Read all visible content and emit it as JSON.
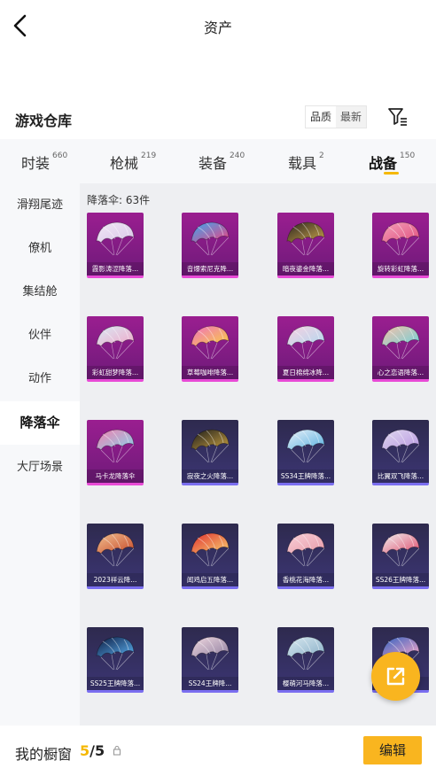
{
  "header": {
    "title": "资产"
  },
  "warehouse": {
    "title": "游戏仓库",
    "sort_options": [
      "品质",
      "最新"
    ]
  },
  "tabs": [
    {
      "label": "时装",
      "count": "660"
    },
    {
      "label": "枪械",
      "count": "219"
    },
    {
      "label": "装备",
      "count": "240"
    },
    {
      "label": "载具",
      "count": "2"
    },
    {
      "label": "战备",
      "count": "150"
    }
  ],
  "sidebar": {
    "items": [
      "滑翔尾迹",
      "僚机",
      "集结舱",
      "伙伴",
      "动作",
      "降落伞",
      "大厅场景"
    ]
  },
  "content": {
    "header": "降落伞: 63件",
    "items": [
      {
        "name": "霞影涛涩降落...",
        "rarity": "pink",
        "colors": [
          "#f1e8f5",
          "#d9c5e8"
        ]
      },
      {
        "name": "音爆索尼克降...",
        "rarity": "pink",
        "colors": [
          "#3aa8f0",
          "#f04080"
        ]
      },
      {
        "name": "暗夜鎏金降落...",
        "rarity": "pink",
        "colors": [
          "#2b2620",
          "#c9a24a"
        ]
      },
      {
        "name": "旋转彩虹降落...",
        "rarity": "pink",
        "colors": [
          "#f4a0b8",
          "#e05080"
        ]
      },
      {
        "name": "彩虹甜梦降落...",
        "rarity": "pink",
        "colors": [
          "#d8e8f4",
          "#f0a8c8"
        ]
      },
      {
        "name": "草莓咖啡降落...",
        "rarity": "pink",
        "colors": [
          "#f070c0",
          "#f8d040"
        ]
      },
      {
        "name": "夏日棉绵冰降...",
        "rarity": "pink",
        "colors": [
          "#f8d0e0",
          "#b0d8f0"
        ]
      },
      {
        "name": "心之恋语降落...",
        "rarity": "pink",
        "colors": [
          "#f8c0a8",
          "#70d0d8"
        ]
      },
      {
        "name": "马卡龙降落伞",
        "rarity": "pink",
        "colors": [
          "#f080b0",
          "#8ad0e8"
        ]
      },
      {
        "name": "寂夜之火降落...",
        "rarity": "purple",
        "colors": [
          "#1c1c1c",
          "#c8a040"
        ]
      },
      {
        "name": "SS34王牌降落...",
        "rarity": "purple",
        "colors": [
          "#e8f0f8",
          "#5ab0e0"
        ]
      },
      {
        "name": "比翼双飞降落...",
        "rarity": "purple",
        "colors": [
          "#e0d8f0",
          "#b898e0"
        ]
      },
      {
        "name": "2023祥云降...",
        "rarity": "purple",
        "colors": [
          "#f0c090",
          "#c84a2a"
        ]
      },
      {
        "name": "闻鸡启五降落...",
        "rarity": "purple",
        "colors": [
          "#e03030",
          "#f8d070"
        ]
      },
      {
        "name": "香桃花海降落...",
        "rarity": "purple",
        "colors": [
          "#f8d0d8",
          "#e89aa8"
        ]
      },
      {
        "name": "SS26王牌降落...",
        "rarity": "purple",
        "colors": [
          "#f0f0f0",
          "#e05070"
        ]
      },
      {
        "name": "SS25王牌降落...",
        "rarity": "purple",
        "colors": [
          "#0c1a40",
          "#5ab0f0"
        ]
      },
      {
        "name": "SS24王牌降...",
        "rarity": "purple",
        "colors": [
          "#f0d8e0",
          "#9080a0"
        ]
      },
      {
        "name": "樱萌河马降落...",
        "rarity": "purple",
        "colors": [
          "#d8e8f0",
          "#8ab0c8"
        ]
      },
      {
        "name": "",
        "rarity": "purple",
        "colors": [
          "#3060c0",
          "#f8a8c8"
        ]
      }
    ]
  },
  "bottom": {
    "showcase_label": "我的橱窗",
    "count_current": "5",
    "count_total": "/5",
    "edit_label": "编辑"
  }
}
